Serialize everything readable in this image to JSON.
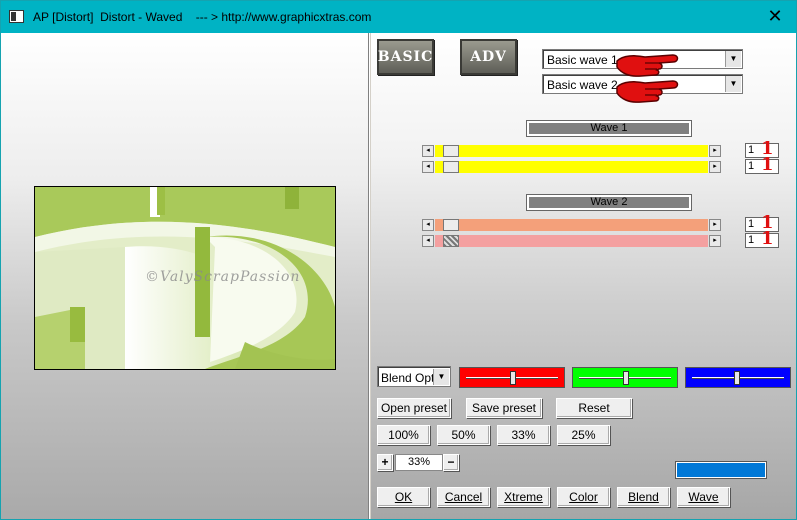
{
  "window": {
    "title": "AP [Distort]  Distort - Waved    --- > http://www.graphicxtras.com",
    "close_glyph": "✕"
  },
  "preview": {
    "watermark": "©ValyScrapPassion"
  },
  "mode_buttons": {
    "basic": "BASIC",
    "adv": "ADV"
  },
  "wave_selectors": [
    {
      "value": "Basic wave 1"
    },
    {
      "value": "Basic wave 2"
    }
  ],
  "wave1": {
    "label": "Wave 1",
    "color": "#ffff00",
    "sliders": [
      {
        "value": "1"
      },
      {
        "value": "1"
      }
    ]
  },
  "wave2": {
    "label": "Wave 2",
    "colors": [
      "#f4a07a",
      "#f4a0a0"
    ],
    "sliders": [
      {
        "value": "1"
      },
      {
        "value": "1"
      }
    ]
  },
  "annotation_digit": "1",
  "blend": {
    "select_value": "Blend Optio",
    "channel_colors": [
      "#ff0000",
      "#00ff00",
      "#0000ff"
    ]
  },
  "preset_buttons": {
    "open": "Open preset",
    "save": "Save preset",
    "reset": "Reset"
  },
  "zoom_buttons": [
    "100%",
    "50%",
    "33%",
    "25%"
  ],
  "zoom": {
    "plus": "+",
    "minus": "−",
    "value": "33%"
  },
  "status_color": "#0078d7",
  "action_buttons": {
    "ok": "OK",
    "cancel": "Cancel",
    "xtreme": "Xtreme",
    "color": "Color",
    "blend": "Blend",
    "wave": "Wave"
  }
}
